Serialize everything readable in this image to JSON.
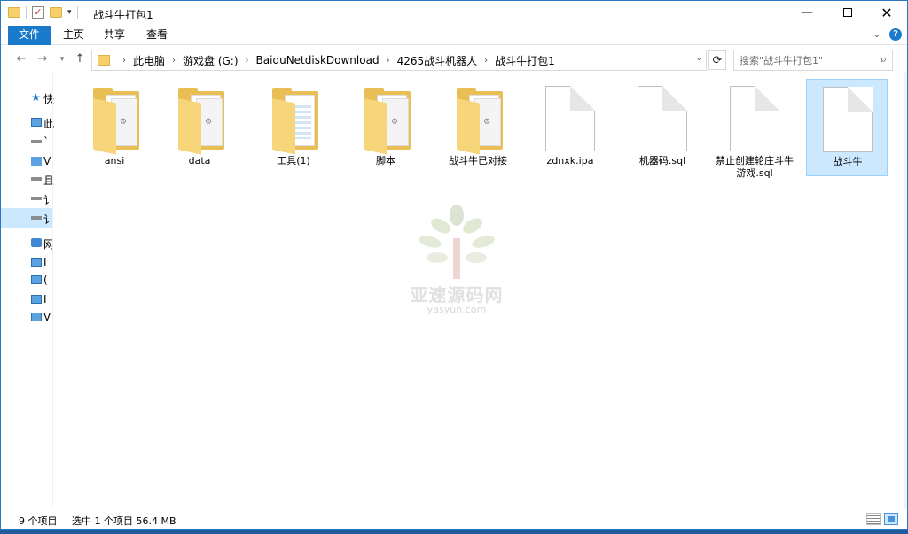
{
  "window": {
    "title": "战斗牛打包1"
  },
  "title_buttons": {
    "minimize": "—",
    "close": "✕"
  },
  "ribbon": {
    "tabs": [
      "文件",
      "主页",
      "共享",
      "查看"
    ]
  },
  "address": {
    "crumbs": [
      "此电脑",
      "游戏盘 (G:)",
      "BaiduNetdiskDownload",
      "4265战斗机器人",
      "战斗牛打包1"
    ]
  },
  "search": {
    "placeholder": "搜索\"战斗牛打包1\""
  },
  "nav_pane": {
    "items": [
      {
        "icon": "star-icon",
        "label": "快"
      },
      {
        "icon": "pc-icon",
        "label": "此"
      },
      {
        "icon": "drive-icon",
        "label": "`"
      },
      {
        "icon": "network-drive-icon",
        "label": "V"
      },
      {
        "icon": "drive-icon",
        "label": "且"
      },
      {
        "icon": "drive-icon",
        "label": "讠"
      },
      {
        "icon": "drive-icon",
        "label": "讠"
      },
      {
        "icon": "network-icon",
        "label": "网"
      },
      {
        "icon": "monitor-icon",
        "label": "I"
      },
      {
        "icon": "monitor-icon",
        "label": "("
      },
      {
        "icon": "monitor-icon",
        "label": "I"
      },
      {
        "icon": "monitor-icon",
        "label": "V"
      }
    ]
  },
  "files": [
    {
      "name": "ansi",
      "kind": "folder"
    },
    {
      "name": "data",
      "kind": "folder"
    },
    {
      "name": "工具(1)",
      "kind": "folder-doc"
    },
    {
      "name": "脚本",
      "kind": "folder"
    },
    {
      "name": "战斗牛已对接",
      "kind": "folder"
    },
    {
      "name": "zdnxk.ipa",
      "kind": "file"
    },
    {
      "name": "机器码.sql",
      "kind": "file"
    },
    {
      "name": "禁止创建轮庄斗牛游戏.sql",
      "kind": "file"
    },
    {
      "name": "战斗牛",
      "kind": "file",
      "selected": true
    }
  ],
  "watermark": {
    "title": "亚速源码网",
    "subtitle": "yasyun.com"
  },
  "status": {
    "count": "9 个项目",
    "selection": "选中 1 个项目  56.4 MB"
  },
  "colors": {
    "accent": "#1979ca",
    "selection": "#cce8ff",
    "folder": "#e9bf55"
  }
}
